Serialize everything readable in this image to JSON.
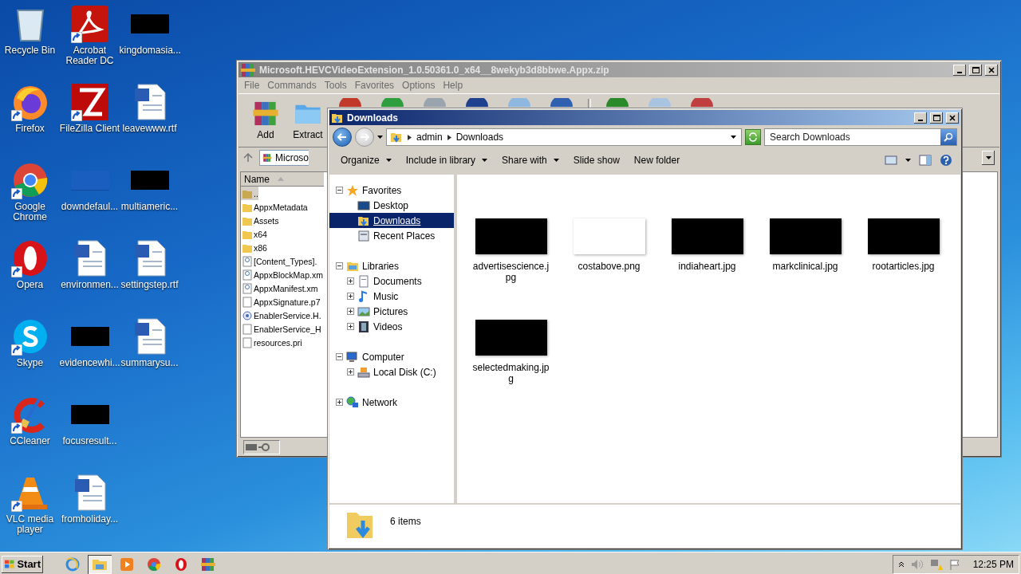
{
  "desktop_icons": [
    {
      "label": "Recycle Bin",
      "kind": "bin",
      "shortcut": false
    },
    {
      "label": "Firefox",
      "kind": "fox",
      "shortcut": true
    },
    {
      "label": "Google Chrome",
      "kind": "chrome",
      "shortcut": true
    },
    {
      "label": "Opera",
      "kind": "opera",
      "shortcut": true
    },
    {
      "label": "Skype",
      "kind": "skype",
      "shortcut": true
    },
    {
      "label": "CCleaner",
      "kind": "cleaner",
      "shortcut": true
    },
    {
      "label": "VLC media player",
      "kind": "cone",
      "shortcut": true
    },
    {
      "label": "Acrobat Reader DC",
      "kind": "pdf",
      "shortcut": true
    },
    {
      "label": "FileZilla Client",
      "kind": "ftp",
      "shortcut": true
    },
    {
      "label": "downdefaul...",
      "kind": "blank",
      "shortcut": false
    },
    {
      "label": "environmen...",
      "kind": "doc",
      "shortcut": false
    },
    {
      "label": "evidencewhi...",
      "kind": "thumb",
      "shortcut": false
    },
    {
      "label": "focusresult...",
      "kind": "thumb",
      "shortcut": false
    },
    {
      "label": "fromholiday...",
      "kind": "doc",
      "shortcut": false
    },
    {
      "label": "kingdomasia...",
      "kind": "thumb",
      "shortcut": false
    },
    {
      "label": "leavewww.rtf",
      "kind": "doc",
      "shortcut": false
    },
    {
      "label": "multiameric...",
      "kind": "thumb",
      "shortcut": false
    },
    {
      "label": "settingstep.rtf",
      "kind": "doc",
      "shortcut": false
    },
    {
      "label": "summarysu...",
      "kind": "doc",
      "shortcut": false
    }
  ],
  "winrar": {
    "title": "Microsoft.HEVCVideoExtension_1.0.50361.0_x64__8wekyb3d8bbwe.Appx.zip",
    "menu": [
      "File",
      "Commands",
      "Tools",
      "Favorites",
      "Options",
      "Help"
    ],
    "toolbar": [
      {
        "label": "Add",
        "kind": "add"
      },
      {
        "label": "Extract",
        "kind": "extract"
      },
      {
        "kind": "tool",
        "color": "#c0392b"
      },
      {
        "kind": "tool",
        "color": "#2e9e3e"
      },
      {
        "kind": "tool",
        "color": "#9aa4ae"
      },
      {
        "kind": "tool",
        "color": "#1f3f8f"
      },
      {
        "kind": "tool",
        "color": "#8fb8e0"
      },
      {
        "kind": "tool",
        "color": "#3060b0"
      },
      {
        "kind": "separator"
      },
      {
        "kind": "tool",
        "color": "#2a8a2a"
      },
      {
        "kind": "tool",
        "color": "#a8c4e0"
      },
      {
        "kind": "tool",
        "color": "#c04040"
      }
    ],
    "address": "Microso",
    "column": "Name",
    "files": [
      {
        "name": "..",
        "kind": "parent",
        "selected": true
      },
      {
        "name": "AppxMetadata",
        "kind": "folder",
        "selected": false
      },
      {
        "name": "Assets",
        "kind": "folder",
        "selected": false
      },
      {
        "name": "x64",
        "kind": "folder",
        "selected": false
      },
      {
        "name": "x86",
        "kind": "folder",
        "selected": false
      },
      {
        "name": "[Content_Types].",
        "kind": "xml",
        "selected": false
      },
      {
        "name": "AppxBlockMap.xm",
        "kind": "xml",
        "selected": false
      },
      {
        "name": "AppxManifest.xm",
        "kind": "xml",
        "selected": false
      },
      {
        "name": "AppxSignature.p7",
        "kind": "file",
        "selected": false
      },
      {
        "name": "EnablerService.H.",
        "kind": "dll",
        "selected": false
      },
      {
        "name": "EnablerService_H",
        "kind": "file",
        "selected": false
      },
      {
        "name": "resources.pri",
        "kind": "file",
        "selected": false
      }
    ]
  },
  "explorer": {
    "title": "Downloads",
    "breadcrumb": [
      "admin",
      "Downloads"
    ],
    "search": {
      "placeholder": "Search Downloads"
    },
    "commands": [
      {
        "label": "Organize",
        "dropdown": true
      },
      {
        "label": "Include in library",
        "dropdown": true
      },
      {
        "label": "Share with",
        "dropdown": true
      },
      {
        "label": "Slide show",
        "dropdown": false
      },
      {
        "label": "New folder",
        "dropdown": false
      }
    ],
    "tree": [
      {
        "label": "Favorites",
        "kind": "star",
        "expanded": true,
        "selected": false,
        "children": [
          {
            "label": "Desktop",
            "kind": "desktop",
            "selected": false
          },
          {
            "label": "Downloads",
            "kind": "downloads",
            "selected": true
          },
          {
            "label": "Recent Places",
            "kind": "recent",
            "selected": false
          }
        ]
      },
      {
        "label": "Libraries",
        "kind": "library",
        "expanded": true,
        "selected": false,
        "children": [
          {
            "label": "Documents",
            "kind": "documents",
            "expanded": false,
            "selected": false
          },
          {
            "label": "Music",
            "kind": "music",
            "expanded": false,
            "selected": false
          },
          {
            "label": "Pictures",
            "kind": "pictures",
            "expanded": false,
            "selected": false
          },
          {
            "label": "Videos",
            "kind": "videos",
            "expanded": false,
            "selected": false
          }
        ]
      },
      {
        "label": "Computer",
        "kind": "computer",
        "expanded": true,
        "selected": false,
        "children": [
          {
            "label": "Local Disk (C:)",
            "kind": "disk",
            "expanded": false,
            "selected": false
          }
        ]
      },
      {
        "label": "Network",
        "kind": "network",
        "expanded": false,
        "selected": false
      }
    ],
    "files": [
      {
        "name": "advertisescience.jpg",
        "kind": "dark"
      },
      {
        "name": "costabove.png",
        "kind": "light"
      },
      {
        "name": "indiaheart.jpg",
        "kind": "dark"
      },
      {
        "name": "markclinical.jpg",
        "kind": "dark"
      },
      {
        "name": "rootarticles.jpg",
        "kind": "dark"
      },
      {
        "name": "selectedmaking.jpg",
        "kind": "dark"
      }
    ],
    "status": "6 items"
  },
  "taskbar": {
    "start": "Start",
    "apps": [
      {
        "kind": "ie",
        "selected": false
      },
      {
        "kind": "explorer",
        "selected": true
      },
      {
        "kind": "media",
        "selected": false
      },
      {
        "kind": "chrome",
        "selected": false
      },
      {
        "kind": "opera",
        "selected": false
      },
      {
        "kind": "winrar",
        "selected": false
      }
    ],
    "clock": "12:25 PM"
  }
}
